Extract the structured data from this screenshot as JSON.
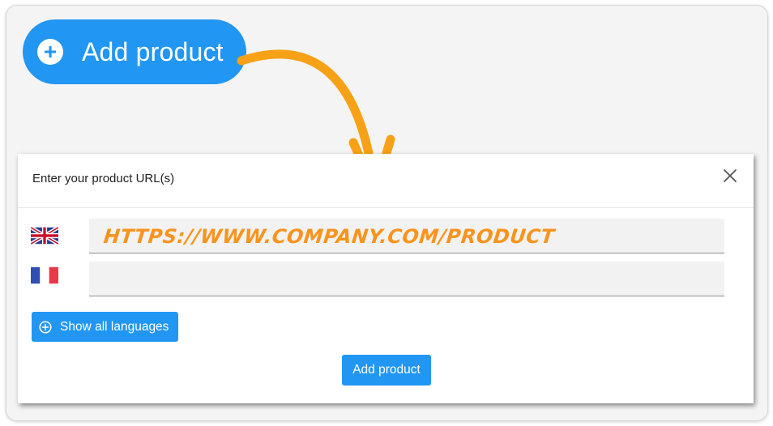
{
  "hero_button": {
    "label": "Add product",
    "icon": "plus-icon"
  },
  "modal": {
    "title": "Enter your product URL(s)",
    "close_icon": "close-icon",
    "rows": [
      {
        "language": "English",
        "flag": "uk-flag-icon",
        "value": "HTTPS://WWW.COMPANY.COM/PRODUCT"
      },
      {
        "language": "French",
        "flag": "fr-flag-icon",
        "value": ""
      }
    ],
    "show_languages_label": "Show all languages",
    "show_languages_icon": "plus-circle-icon",
    "submit_label": "Add product"
  },
  "colors": {
    "accent": "#2196f3",
    "annotation": "#f7941d"
  }
}
